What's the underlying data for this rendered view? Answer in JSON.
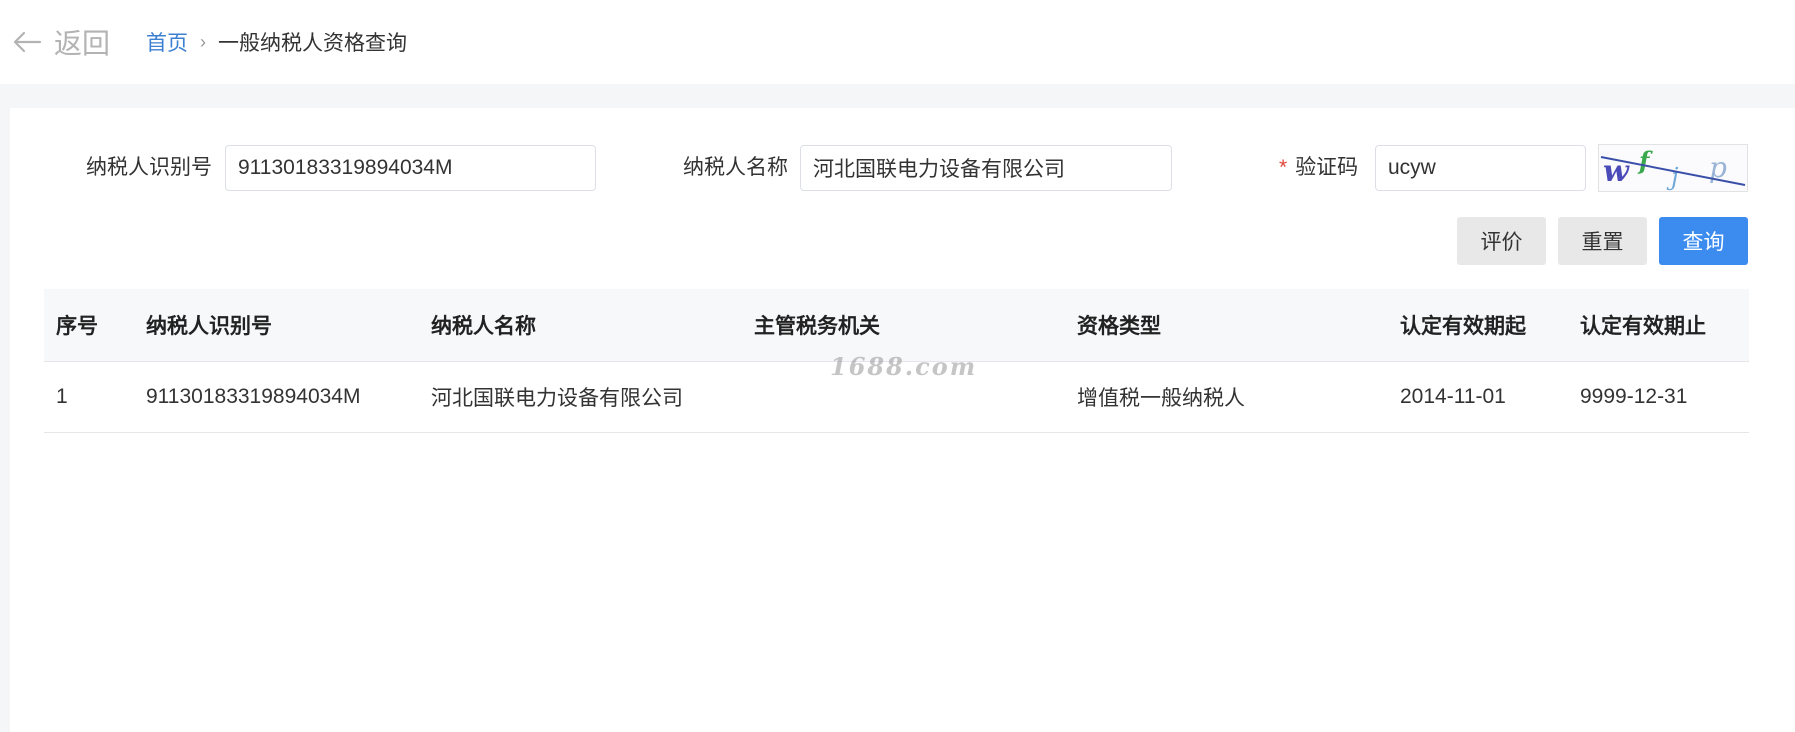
{
  "header": {
    "back_label": "返回",
    "breadcrumb": {
      "home": "首页",
      "separator": "›",
      "current": "一般纳税人资格查询"
    }
  },
  "form": {
    "taxpayer_id": {
      "label": "纳税人识别号",
      "value": "91130183319894034M"
    },
    "taxpayer_name": {
      "label": "纳税人名称",
      "value": "河北国联电力设备有限公司"
    },
    "captcha": {
      "required_mark": "*",
      "label": "验证码",
      "value": "ucyw",
      "image_text": "wfjp"
    }
  },
  "buttons": {
    "evaluate": "评价",
    "reset": "重置",
    "query": "查询"
  },
  "table": {
    "headers": [
      "序号",
      "纳税人识别号",
      "纳税人名称",
      "主管税务机关",
      "资格类型",
      "认定有效期起",
      "认定有效期止"
    ],
    "rows": [
      [
        "1",
        "91130183319894034M",
        "河北国联电力设备有限公司",
        "",
        "增值税一般纳税人",
        "2014-11-01",
        "9999-12-31"
      ]
    ]
  },
  "watermark": "1688.com",
  "colors": {
    "primary": "#3c8cf0",
    "link": "#3d7fd1",
    "required": "#e0453a"
  }
}
